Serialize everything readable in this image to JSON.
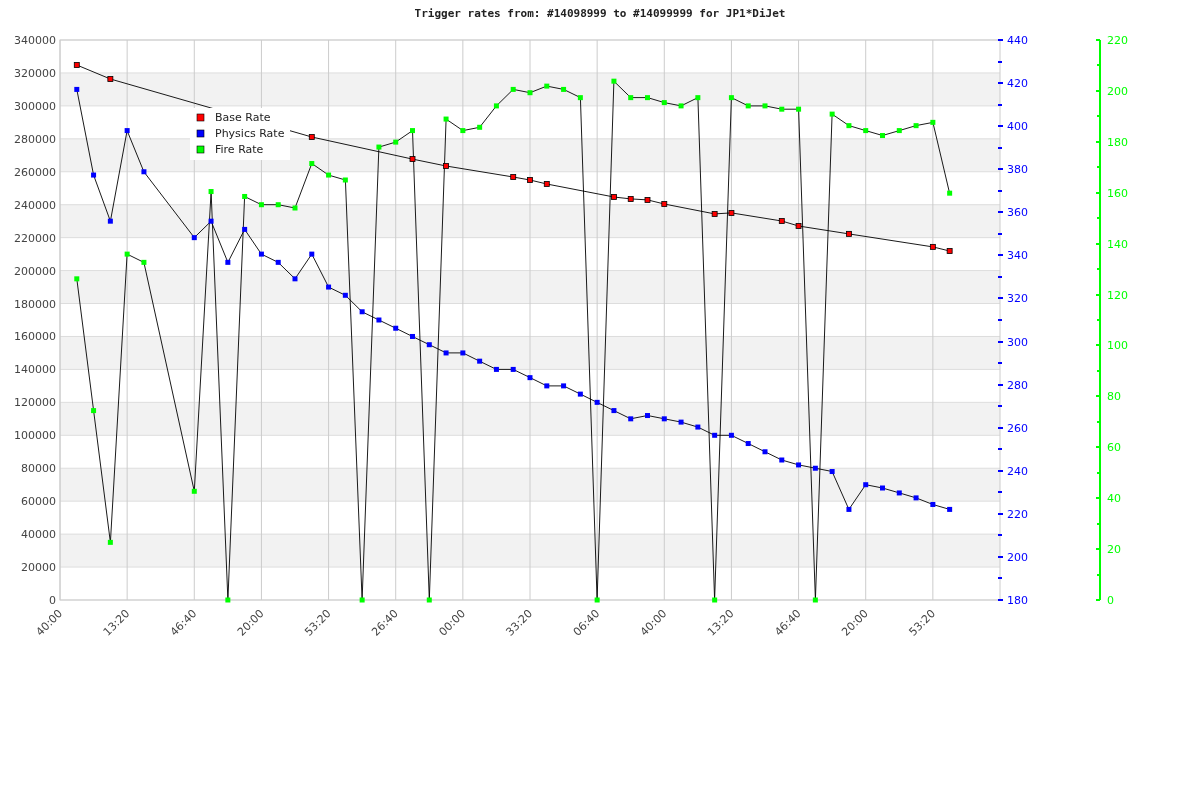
{
  "chart": {
    "chart_data": {
      "type": "line",
      "title": "Trigger rates from: #14098999 to #14099999 for JP1*DiJet",
      "ylim": [
        0,
        340000
      ],
      "grid": true,
      "legend": true,
      "categories": [
        "40:00",
        null,
        null,
        null,
        "13:20",
        null,
        null,
        null,
        "46:40",
        null,
        null,
        null,
        "20:00",
        null,
        null,
        null,
        "53:20",
        null,
        null,
        null,
        "26:40",
        null,
        null,
        null,
        "00:00",
        null,
        null,
        null,
        "33:20",
        null,
        null,
        null,
        "06:40",
        null,
        null,
        null,
        "40:00",
        null,
        null,
        null,
        "13:20",
        null,
        null,
        null,
        "46:40",
        null,
        null,
        null,
        "20:00",
        null,
        null,
        null,
        "53:20",
        null,
        null,
        null,
        null
      ],
      "yticks": [
        {
          "value": 0,
          "label": "0"
        },
        {
          "value": 20000,
          "label": "20000"
        },
        {
          "value": 40000,
          "label": "40000"
        },
        {
          "value": 60000,
          "label": "60000"
        },
        {
          "value": 80000,
          "label": "80000"
        },
        {
          "value": 100000,
          "label": "100000"
        },
        {
          "value": 120000,
          "label": "120000"
        },
        {
          "value": 140000,
          "label": "140000"
        },
        {
          "value": 160000,
          "label": "160000"
        },
        {
          "value": 180000,
          "label": "180000"
        },
        {
          "value": 200000,
          "label": "200000"
        },
        {
          "value": 220000,
          "label": "220000"
        },
        {
          "value": 240000,
          "label": "240000"
        },
        {
          "value": 260000,
          "label": "260000"
        },
        {
          "value": 280000,
          "label": "280000"
        },
        {
          "value": 300000,
          "label": "300000"
        },
        {
          "value": 320000,
          "label": "320000"
        },
        {
          "value": 340000,
          "label": "340000"
        }
      ],
      "series": [
        {
          "name": "Base Rate",
          "color": "#ff0000",
          "marker": "square",
          "values": [
            null,
            324800,
            null,
            316300,
            null,
            null,
            null,
            null,
            null,
            null,
            null,
            null,
            null,
            null,
            null,
            281100,
            null,
            null,
            null,
            null,
            null,
            267700,
            null,
            263500,
            null,
            null,
            null,
            256800,
            255000,
            252600,
            null,
            null,
            null,
            244700,
            243500,
            242900,
            240400,
            null,
            null,
            234400,
            235000,
            null,
            null,
            230100,
            227100,
            null,
            null,
            222300,
            null,
            null,
            null,
            null,
            214400,
            211900,
            null,
            null,
            null
          ]
        },
        {
          "name": "Physics Rate",
          "color": "#0000ff",
          "marker": "square",
          "values": [
            null,
            310000,
            258000,
            230000,
            285000,
            260000,
            null,
            null,
            220000,
            230000,
            205000,
            225000,
            210000,
            205000,
            195000,
            210000,
            190000,
            185000,
            175000,
            170000,
            165000,
            160000,
            155000,
            150000,
            150000,
            145000,
            140000,
            140000,
            135000,
            130000,
            130000,
            125000,
            120000,
            115000,
            110000,
            112000,
            110000,
            108000,
            105000,
            100000,
            100000,
            95000,
            90000,
            85000,
            82000,
            80000,
            78000,
            55000,
            70000,
            68000,
            65000,
            62000,
            58000,
            55000,
            null,
            null,
            null
          ]
        },
        {
          "name": "Fire Rate",
          "color": "#00ff00",
          "marker": "square",
          "values": [
            null,
            195000,
            115000,
            35000,
            210000,
            205000,
            null,
            null,
            66000,
            248000,
            0,
            245000,
            240000,
            240000,
            238000,
            265000,
            258000,
            255000,
            0,
            275000,
            278000,
            285000,
            0,
            292000,
            285000,
            287000,
            300000,
            310000,
            308000,
            312000,
            310000,
            305000,
            0,
            315000,
            305000,
            305000,
            302000,
            300000,
            305000,
            0,
            305000,
            300000,
            300000,
            298000,
            298000,
            0,
            295000,
            288000,
            285000,
            282000,
            285000,
            288000,
            290000,
            247000,
            null,
            null,
            null
          ]
        }
      ]
    },
    "right_axes": [
      {
        "color": "#0000ff",
        "labels": [
          "440",
          "420",
          "400",
          "380",
          "360",
          "340",
          "320",
          "300",
          "280",
          "260",
          "240",
          "220",
          "200",
          "180"
        ]
      },
      {
        "color": "#00ff00",
        "labels": [
          "220",
          "200",
          "180",
          "160",
          "140",
          "120",
          "100",
          "80",
          "60",
          "40",
          "20",
          "0"
        ]
      }
    ]
  }
}
